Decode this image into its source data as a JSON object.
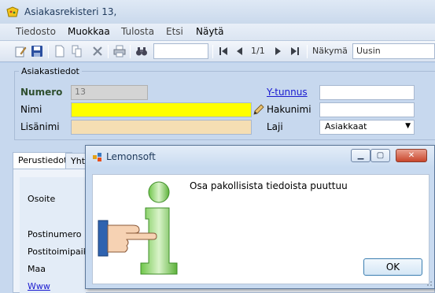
{
  "window": {
    "title": "Asiakasrekisteri 13,"
  },
  "menu": [
    {
      "label": "Tiedosto",
      "dark": false
    },
    {
      "label": "Muokkaa",
      "dark": true
    },
    {
      "label": "Tulosta",
      "dark": false
    },
    {
      "label": "Etsi",
      "dark": false
    },
    {
      "label": "Näytä",
      "dark": true
    }
  ],
  "toolbar": {
    "pager": "1/1",
    "view_label": "Näkymä",
    "view_value": "Uusin",
    "search_value": ""
  },
  "form": {
    "group_caption": "Asiakastiedot",
    "numero_label": "Numero",
    "numero_value": "13",
    "nimi_label": "Nimi",
    "nimi_value": "",
    "lisanimi_label": "Lisänimi",
    "lisanimi_value": "",
    "ytunnus_label": "Y-tunnus",
    "ytunnus_value": "",
    "hakunimi_label": "Hakunimi",
    "hakunimi_value": "",
    "laji_label": "Laji",
    "laji_value": "Asiakkaat",
    "colors": {
      "required": "#ffff00",
      "optional": "#f5deb3",
      "readonly": "#d4d4d4"
    }
  },
  "tabs": [
    {
      "label": "Perustiedot",
      "active": true
    },
    {
      "label": "Yhte",
      "active": false
    }
  ],
  "panel": {
    "osoite_label": "Osoite",
    "postinumero_label": "Postinumero",
    "postitoimipaikka_label": "Postitoimipaikk",
    "maa_label": "Maa",
    "www_label": "Www"
  },
  "dialog": {
    "title": "Lemonsoft",
    "message": "Osa pakollisista tiedoista puuttuu",
    "ok_label": "OK"
  }
}
